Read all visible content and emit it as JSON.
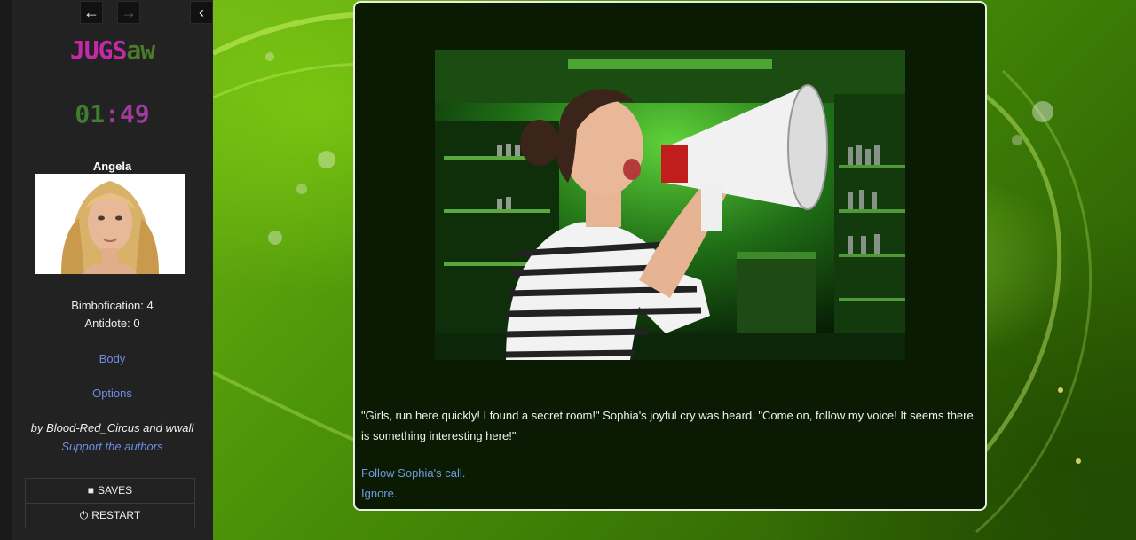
{
  "sidebar": {
    "back_icon": "arrow-left-icon",
    "forward_icon": "arrow-right-icon",
    "collapse_icon": "chevron-left-icon",
    "title_part1": "JUGS",
    "title_part2": "aw",
    "timer_minutes": "01",
    "timer_sep": ":",
    "timer_seconds": "49",
    "character_name": "Angela",
    "bimbofication": "Bimbofication: 4",
    "antidote": "Antidote: 0",
    "body_link": "Body",
    "options_link": "Options",
    "credit": "by Blood-Red_Circus and wwall",
    "support_link": "Support the authors",
    "saves_label": "SAVES",
    "restart_label": "RESTART"
  },
  "passage": {
    "text": "\"Girls, run here quickly! I found a secret room!\" Sophia's joyful cry was heard. \"Come on, follow my voice! It seems there is something interesting here!\"",
    "choices": [
      "Follow Sophia's call.",
      "Ignore."
    ]
  },
  "colors": {
    "title_pink": "#c42aa8",
    "title_green": "#4a7a2a",
    "link_blue": "#6f8fe6",
    "background_green": "#4f8f0a"
  }
}
